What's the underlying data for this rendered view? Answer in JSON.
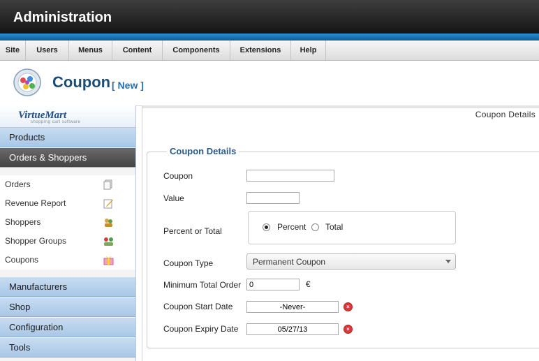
{
  "app": {
    "title": "Administration"
  },
  "menu": [
    {
      "label": "Site"
    },
    {
      "label": "Users"
    },
    {
      "label": "Menus"
    },
    {
      "label": "Content"
    },
    {
      "label": "Components"
    },
    {
      "label": "Extensions"
    },
    {
      "label": "Help"
    }
  ],
  "page": {
    "title": "Coupon",
    "subtitle": "[ New ]"
  },
  "sidebar": {
    "brand": "VirtueMart",
    "tagline": "shopping cart software",
    "sections": [
      {
        "label": "Products"
      },
      {
        "label": "Orders & Shoppers"
      },
      {
        "label": "Manufacturers"
      },
      {
        "label": "Shop"
      },
      {
        "label": "Configuration"
      },
      {
        "label": "Tools"
      }
    ],
    "subitems": [
      {
        "label": "Orders",
        "icon": "orders-icon"
      },
      {
        "label": "Revenue Report",
        "icon": "report-icon"
      },
      {
        "label": "Shoppers",
        "icon": "shoppers-icon"
      },
      {
        "label": "Shopper Groups",
        "icon": "shopper-groups-icon"
      },
      {
        "label": "Coupons",
        "icon": "gift-icon"
      }
    ]
  },
  "main": {
    "breadcrumb": "Coupon Details",
    "fieldset_title": "Coupon Details",
    "fields": {
      "coupon": {
        "label": "Coupon",
        "value": ""
      },
      "value": {
        "label": "Value",
        "value": ""
      },
      "percent_or_total": {
        "label": "Percent or Total",
        "options": [
          "Percent",
          "Total"
        ],
        "selected": "Percent"
      },
      "coupon_type": {
        "label": "Coupon Type",
        "value": "Permanent Coupon"
      },
      "min_total": {
        "label": "Minimum Total Order",
        "value": "0",
        "currency": "€"
      },
      "start_date": {
        "label": "Coupon Start Date",
        "value": "-Never-"
      },
      "expiry_date": {
        "label": "Coupon Expiry Date",
        "value": "05/27/13"
      }
    }
  },
  "colors": {
    "accent": "#1d4d73",
    "menu_blue": "#2a8fd0",
    "sidebar_blue": "#b8d3ee"
  }
}
